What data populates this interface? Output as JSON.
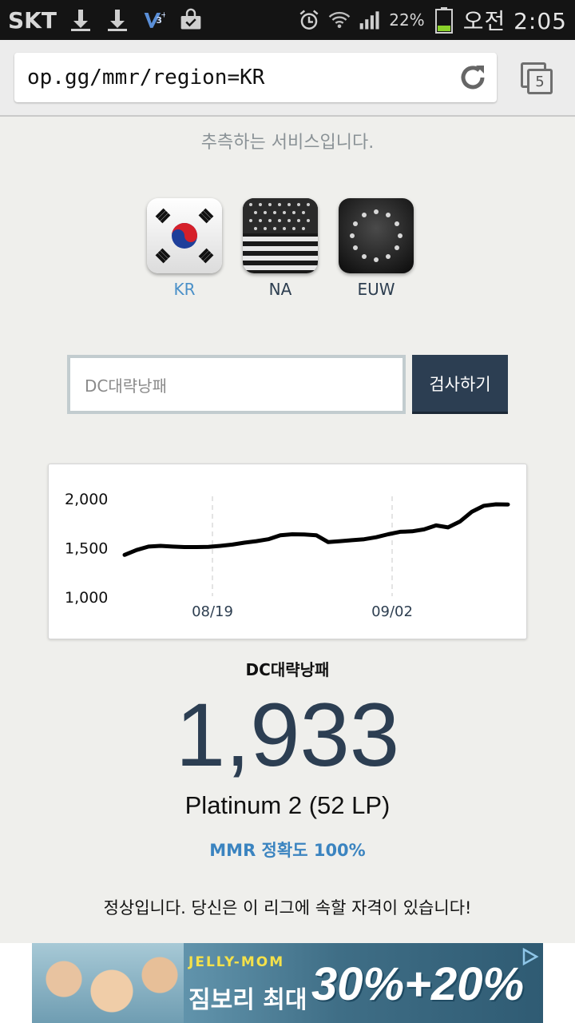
{
  "status_bar": {
    "carrier": "SKT",
    "battery_percent": "22%",
    "clock": "오전 2:05"
  },
  "browser": {
    "url": "op.gg/mmr/region=KR",
    "tab_count": "5"
  },
  "page": {
    "service_text": "추측하는 서비스입니다.",
    "regions": [
      {
        "label": "KR",
        "active": true
      },
      {
        "label": "NA",
        "active": false
      },
      {
        "label": "EUW",
        "active": false
      }
    ],
    "search": {
      "value": "DC대략낭패",
      "button_label": "검사하기"
    },
    "summoner_name": "DC대략낭패",
    "mmr": "1,933",
    "tier": "Platinum 2 (52 LP)",
    "accuracy": "MMR 정확도 100%",
    "verdict": "정상입니다. 당신은 이 리그에 속할 자격이 있습니다!"
  },
  "ad": {
    "brand": "JELLY-MOM",
    "subtitle": "짐보리 최대",
    "promo": "30%+20%"
  },
  "chart_data": {
    "type": "line",
    "y_ticks": [
      "2,000",
      "1,500",
      "1,000"
    ],
    "x_ticks": [
      "08/19",
      "09/02"
    ],
    "ylim": [
      1000,
      2000
    ],
    "series": [
      {
        "values": [
          1420,
          1470,
          1505,
          1512,
          1505,
          1500,
          1500,
          1502,
          1512,
          1525,
          1545,
          1560,
          1580,
          1620,
          1630,
          1628,
          1620,
          1550,
          1560,
          1570,
          1580,
          1600,
          1630,
          1655,
          1660,
          1680,
          1720,
          1700,
          1760,
          1860,
          1920,
          1935,
          1933
        ]
      }
    ]
  }
}
